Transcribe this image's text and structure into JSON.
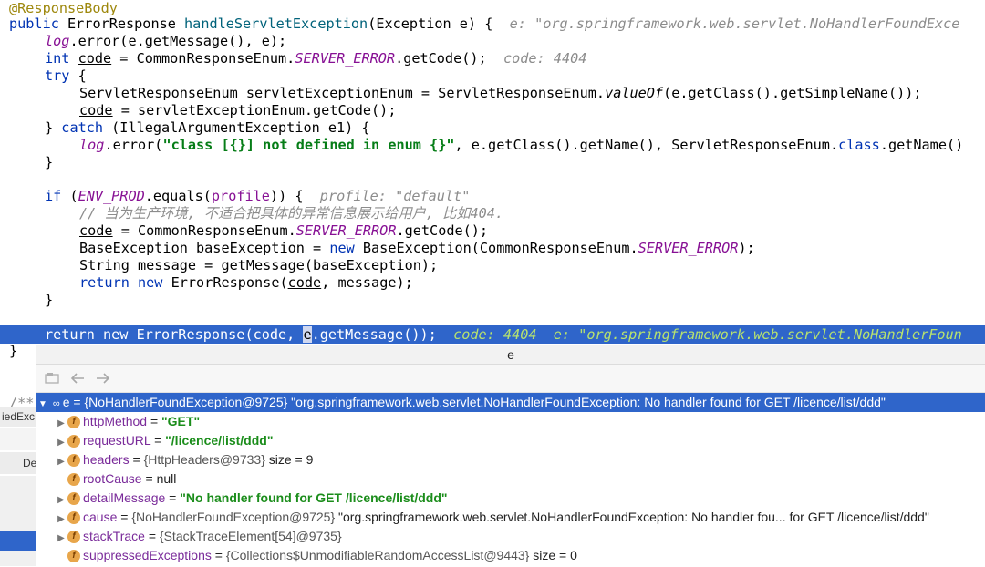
{
  "code": {
    "l01": "@ResponseBody",
    "l02_public": "public ",
    "l02_type": "ErrorResponse ",
    "l02_method": "handleServletException",
    "l02_sig": "(Exception e) {  ",
    "l02_hint": "e: \"org.springframework.web.servlet.NoHandlerFoundExce",
    "l03_log": "log",
    "l03_rest": ".error(e.getMessage(), e);",
    "l04_int": "int ",
    "l04_code": "code",
    "l04_mid": " = CommonResponseEnum.",
    "l04_const": "SERVER_ERROR",
    "l04_end": ".getCode();  ",
    "l04_hint": "code: 4404",
    "l05_try": "try",
    "l05_brace": " {",
    "l06_a": "ServletResponseEnum servletExceptionEnum = ServletResponseEnum.",
    "l06_b": "valueOf",
    "l06_c": "(e.getClass().getSimpleName());",
    "l07_code": "code",
    "l07_rest": " = servletExceptionEnum.getCode();",
    "l08_a": "} ",
    "l08_catch": "catch",
    "l08_b": " (IllegalArgumentException e1) {",
    "l09_log": "log",
    "l09_a": ".error(",
    "l09_str": "\"class [{}] not defined in enum {}\"",
    "l09_b": ", e.getClass().getName(), ServletResponseEnum.",
    "l09_class": "class",
    "l09_c": ".getName()",
    "l10": "}",
    "l11_if": "if ",
    "l11_a": "(",
    "l11_env": "ENV_PROD",
    "l11_b": ".equals(",
    "l11_profile": "profile",
    "l11_c": ")) {  ",
    "l11_hint": "profile: \"default\"",
    "l12_comment": "// 当为生产环境, 不适合把具体的异常信息展示给用户, 比如404.",
    "l13_code": "code",
    "l13_mid": " = CommonResponseEnum.",
    "l13_const": "SERVER_ERROR",
    "l13_end": ".getCode();",
    "l14_a": "BaseException baseException = ",
    "l14_new": "new",
    "l14_b": " BaseException(CommonResponseEnum.",
    "l14_const": "SERVER_ERROR",
    "l14_c": ");",
    "l15": "String message = getMessage(baseException);",
    "l16_return": "return",
    "l16_new": " new",
    "l16_a": " ErrorResponse(",
    "l16_code": "code",
    "l16_b": ", message);",
    "l17": "}",
    "l18_a": "return new ErrorResponse(code, ",
    "l18_e": "e",
    "l18_b": ".getMessage());  ",
    "l18_hint": "code: 4404  e: \"org.springframework.web.servlet.NoHandlerFoun",
    "l19": "}",
    "l20": "/**"
  },
  "stubs": {
    "s1": "iedExc",
    "s2": "De"
  },
  "popup": {
    "title": "e",
    "toolbar": {
      "back_icon": "back-arrow-icon",
      "forward_icon": "forward-arrow-icon"
    },
    "root": {
      "name": "e",
      "value": " = {NoHandlerFoundException@9725} \"org.springframework.web.servlet.NoHandlerFoundException: No handler found for GET /licence/list/ddd\""
    },
    "fields": [
      {
        "name": "httpMethod",
        "eq": " = ",
        "value": "\"GET\"",
        "kind": "str",
        "expandable": true
      },
      {
        "name": "requestURL",
        "eq": " = ",
        "value": "\"/licence/list/ddd\"",
        "kind": "str",
        "expandable": true
      },
      {
        "name": "headers",
        "eq": " = ",
        "value": "{HttpHeaders@9733}",
        "extra": "  size = 9",
        "kind": "obj",
        "expandable": true
      },
      {
        "name": "rootCause",
        "eq": " = ",
        "value": "null",
        "kind": "plain",
        "expandable": false
      },
      {
        "name": "detailMessage",
        "eq": " = ",
        "value": "\"No handler found for GET /licence/list/ddd\"",
        "kind": "str",
        "expandable": true
      },
      {
        "name": "cause",
        "eq": " = ",
        "value": "{NoHandlerFoundException@9725}",
        "extra": " \"org.springframework.web.servlet.NoHandlerFoundException: No handler fou... for GET /licence/list/ddd\"",
        "kind": "obj",
        "expandable": true
      },
      {
        "name": "stackTrace",
        "eq": " = ",
        "value": "{StackTraceElement[54]@9735}",
        "kind": "obj",
        "expandable": true
      },
      {
        "name": "suppressedExceptions",
        "eq": " = ",
        "value": "{Collections$UnmodifiableRandomAccessList@9443}",
        "extra": "  size = 0",
        "kind": "obj",
        "expandable": false
      }
    ]
  }
}
